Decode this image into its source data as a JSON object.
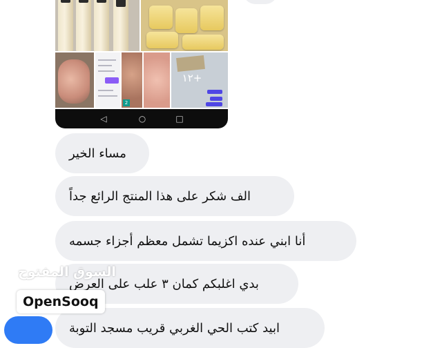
{
  "media": {
    "more_count": "١٢+",
    "thumb_badge": "2",
    "nav": {
      "back_icon": "◁",
      "home_icon": "○",
      "recents_icon": "□"
    }
  },
  "messages": [
    "مساء الخير",
    "الف شكر على هذا المنتج الرائع جداً",
    "أنا ابني عنده اكزيما تشمل معظم أجزاء جسمه",
    "بدي اغلبكم كمان ٣ علب على العرض",
    "ابيد كتب الحي الغربي قريب مسجد التوبة"
  ],
  "watermark": {
    "arabic": "السوق المفتوح",
    "brand": "OpenSooq"
  },
  "colors": {
    "bubble": "#eeeff2",
    "text": "#101010",
    "avatar": "#2f7bf5"
  }
}
